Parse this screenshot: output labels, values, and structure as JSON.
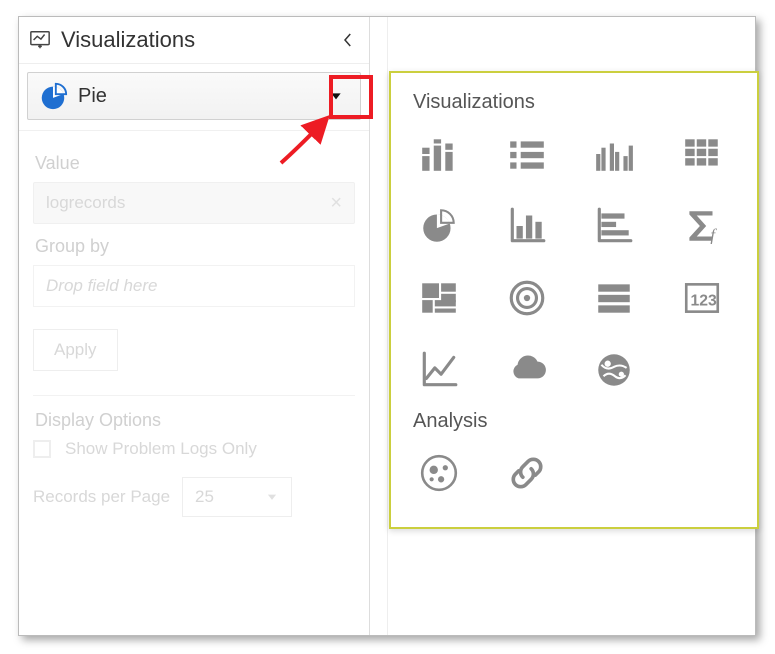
{
  "panel": {
    "title": "Visualizations",
    "selector": {
      "icon": "pie-icon",
      "label": "Pie"
    }
  },
  "form": {
    "value_label": "Value",
    "value_chip": "logrecords",
    "group_by_label": "Group by",
    "drop_placeholder": "Drop field here",
    "apply_label": "Apply"
  },
  "display_options": {
    "title": "Display Options",
    "show_problem_logs_label": "Show Problem Logs Only",
    "records_per_page_label": "Records per Page",
    "records_per_page_value": "25"
  },
  "popover": {
    "visualizations_title": "Visualizations",
    "analysis_title": "Analysis",
    "viz_items": [
      "bar-stacked-icon",
      "list-icon",
      "bar-clustered-icon",
      "grid-icon",
      "pie-icon",
      "bar-vertical-icon",
      "bar-horizontal-icon",
      "sigma-icon",
      "treemap-icon",
      "target-icon",
      "rows-icon",
      "number-icon",
      "line-icon",
      "cloud-icon",
      "globe-icon"
    ],
    "analysis_items": [
      "bubble-icon",
      "link-icon"
    ]
  }
}
